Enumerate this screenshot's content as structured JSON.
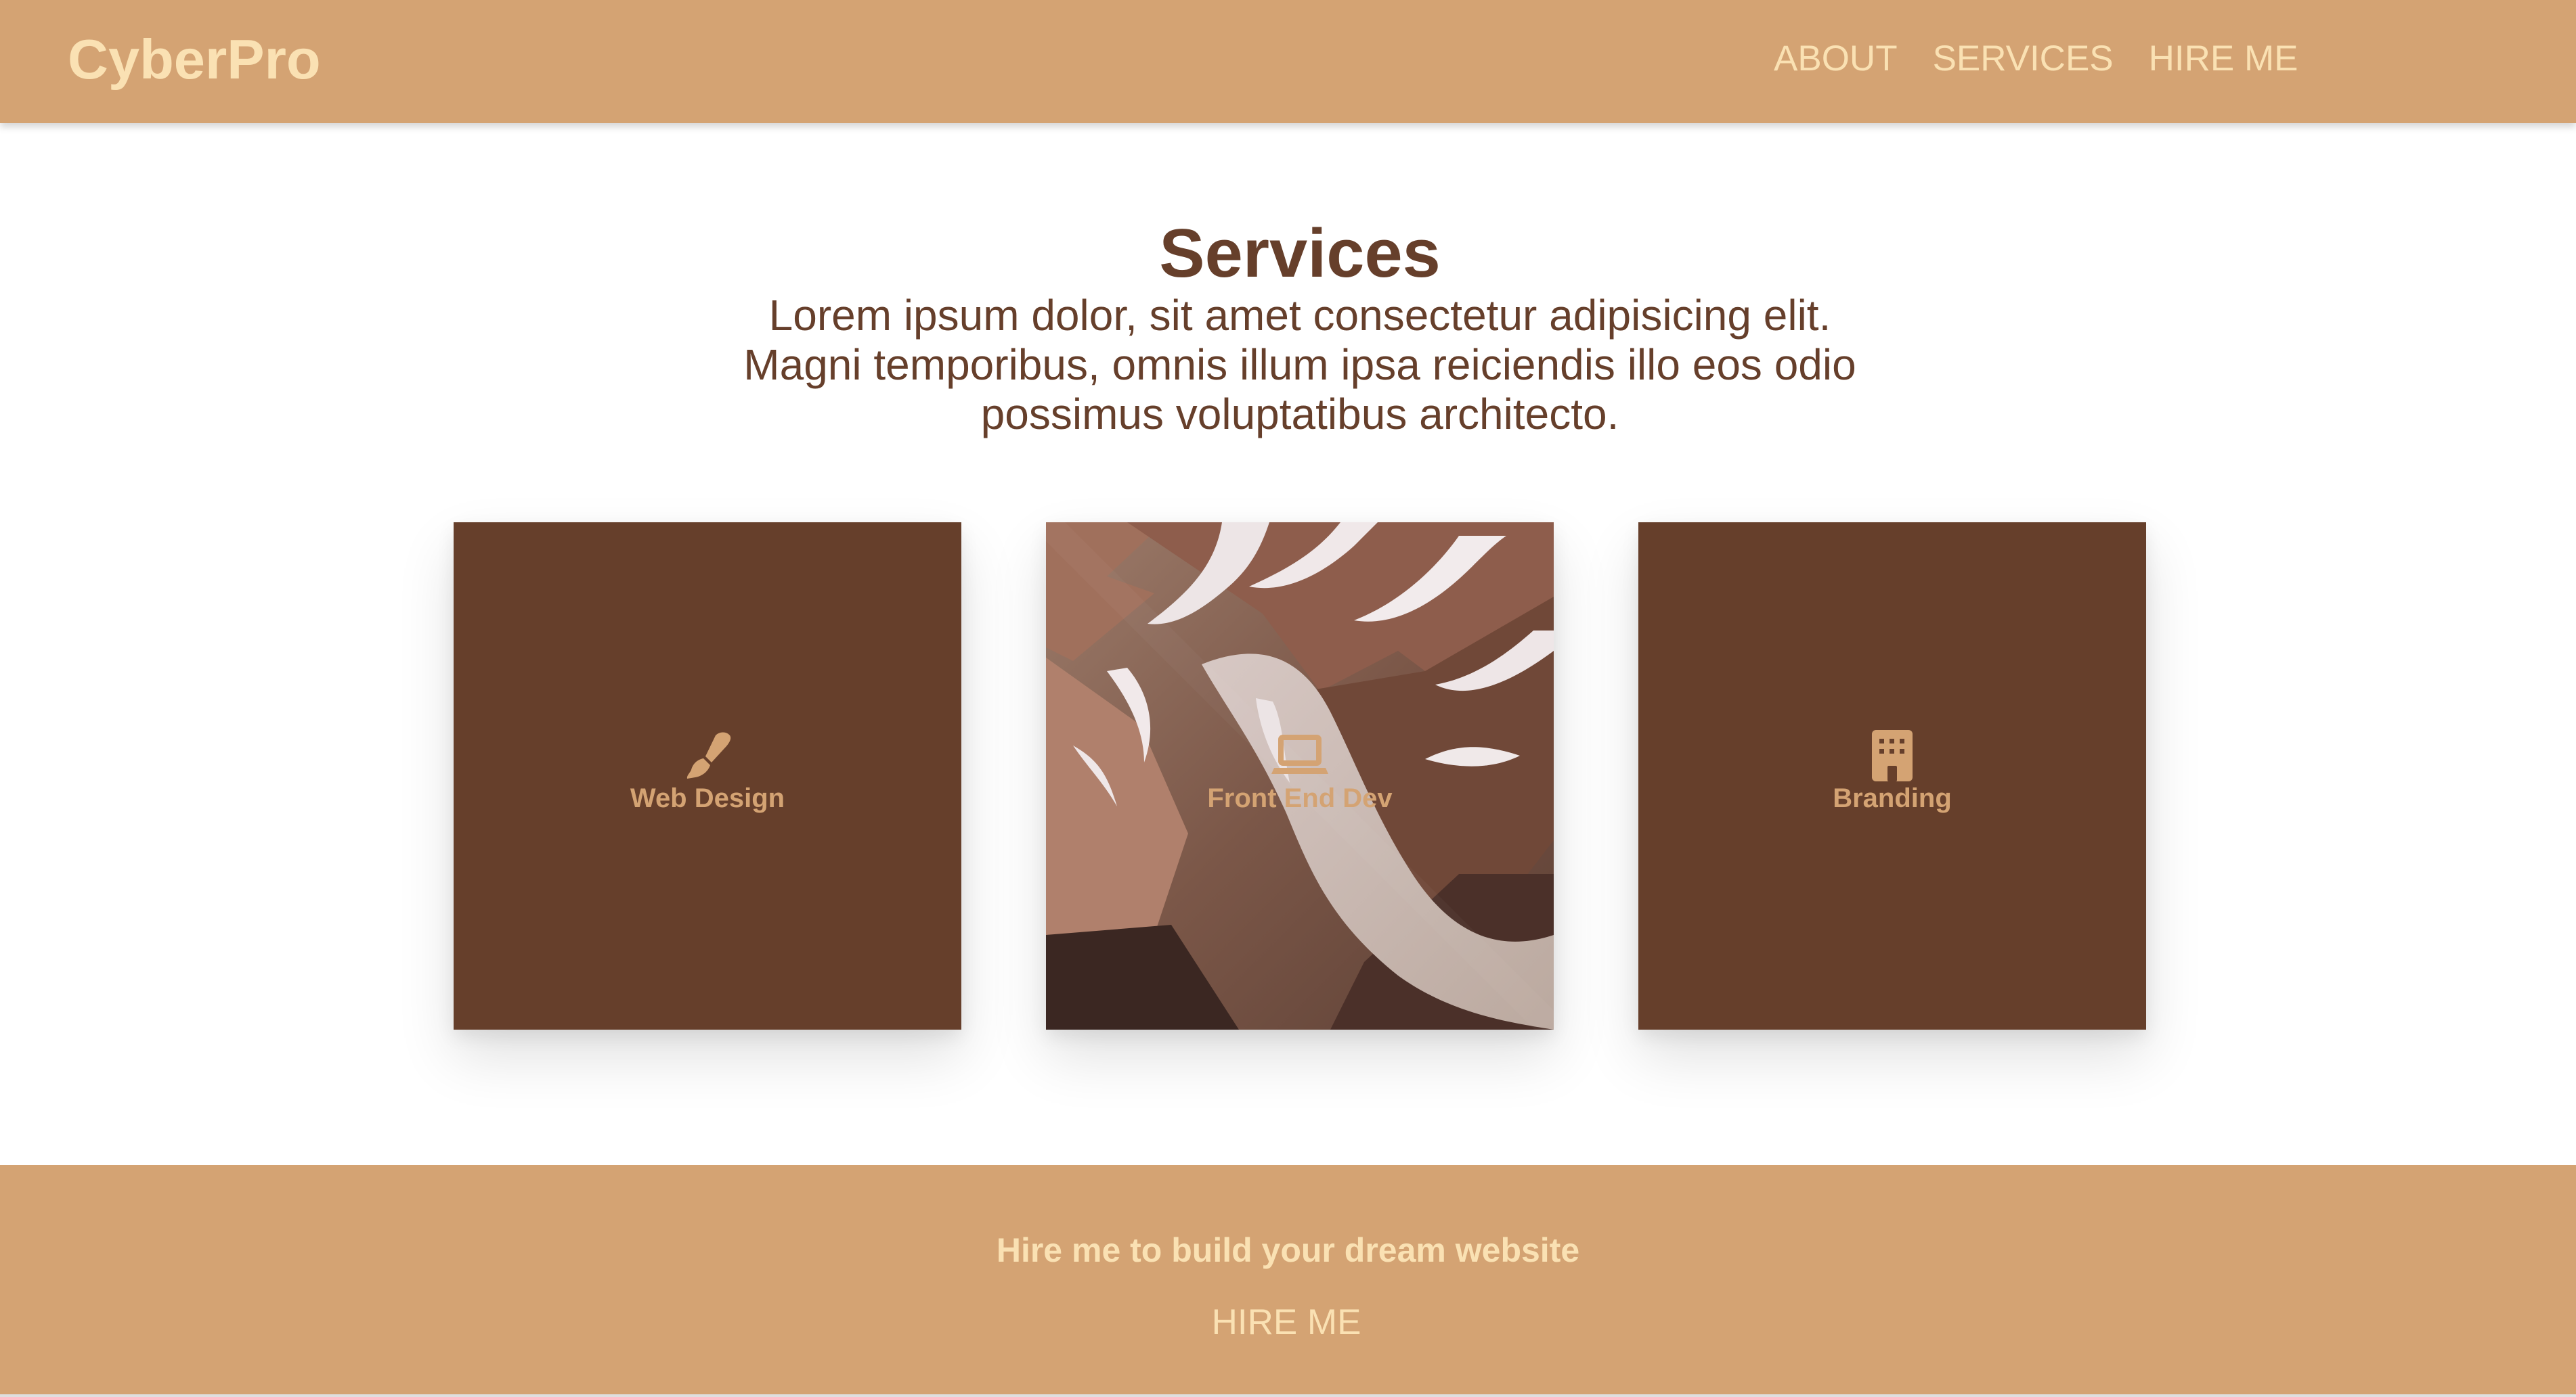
{
  "header": {
    "brand": "CyberPro",
    "nav": {
      "about": "ABOUT",
      "services": "SERVICES",
      "hire_me": "HIRE ME"
    }
  },
  "services": {
    "title": "Services",
    "description": "Lorem ipsum dolor, sit amet consectetur adipisicing elit. Magni temporibus, omnis illum ipsa reiciendis illo eos odio possimus voluptatibus architecto.",
    "cards": [
      {
        "label": "Web Design",
        "icon": "paintbrush-icon",
        "background": "solid"
      },
      {
        "label": "Front End Dev",
        "icon": "laptop-icon",
        "background": "mountain-photo"
      },
      {
        "label": "Branding",
        "icon": "building-icon",
        "background": "solid"
      }
    ]
  },
  "cta": {
    "title": "Hire me to build your dream website",
    "button": "HIRE ME"
  },
  "colors": {
    "primary": "#d4a373",
    "dark_brown": "#663f2b",
    "cream": "#fae1b3",
    "background": "#ffffff"
  }
}
